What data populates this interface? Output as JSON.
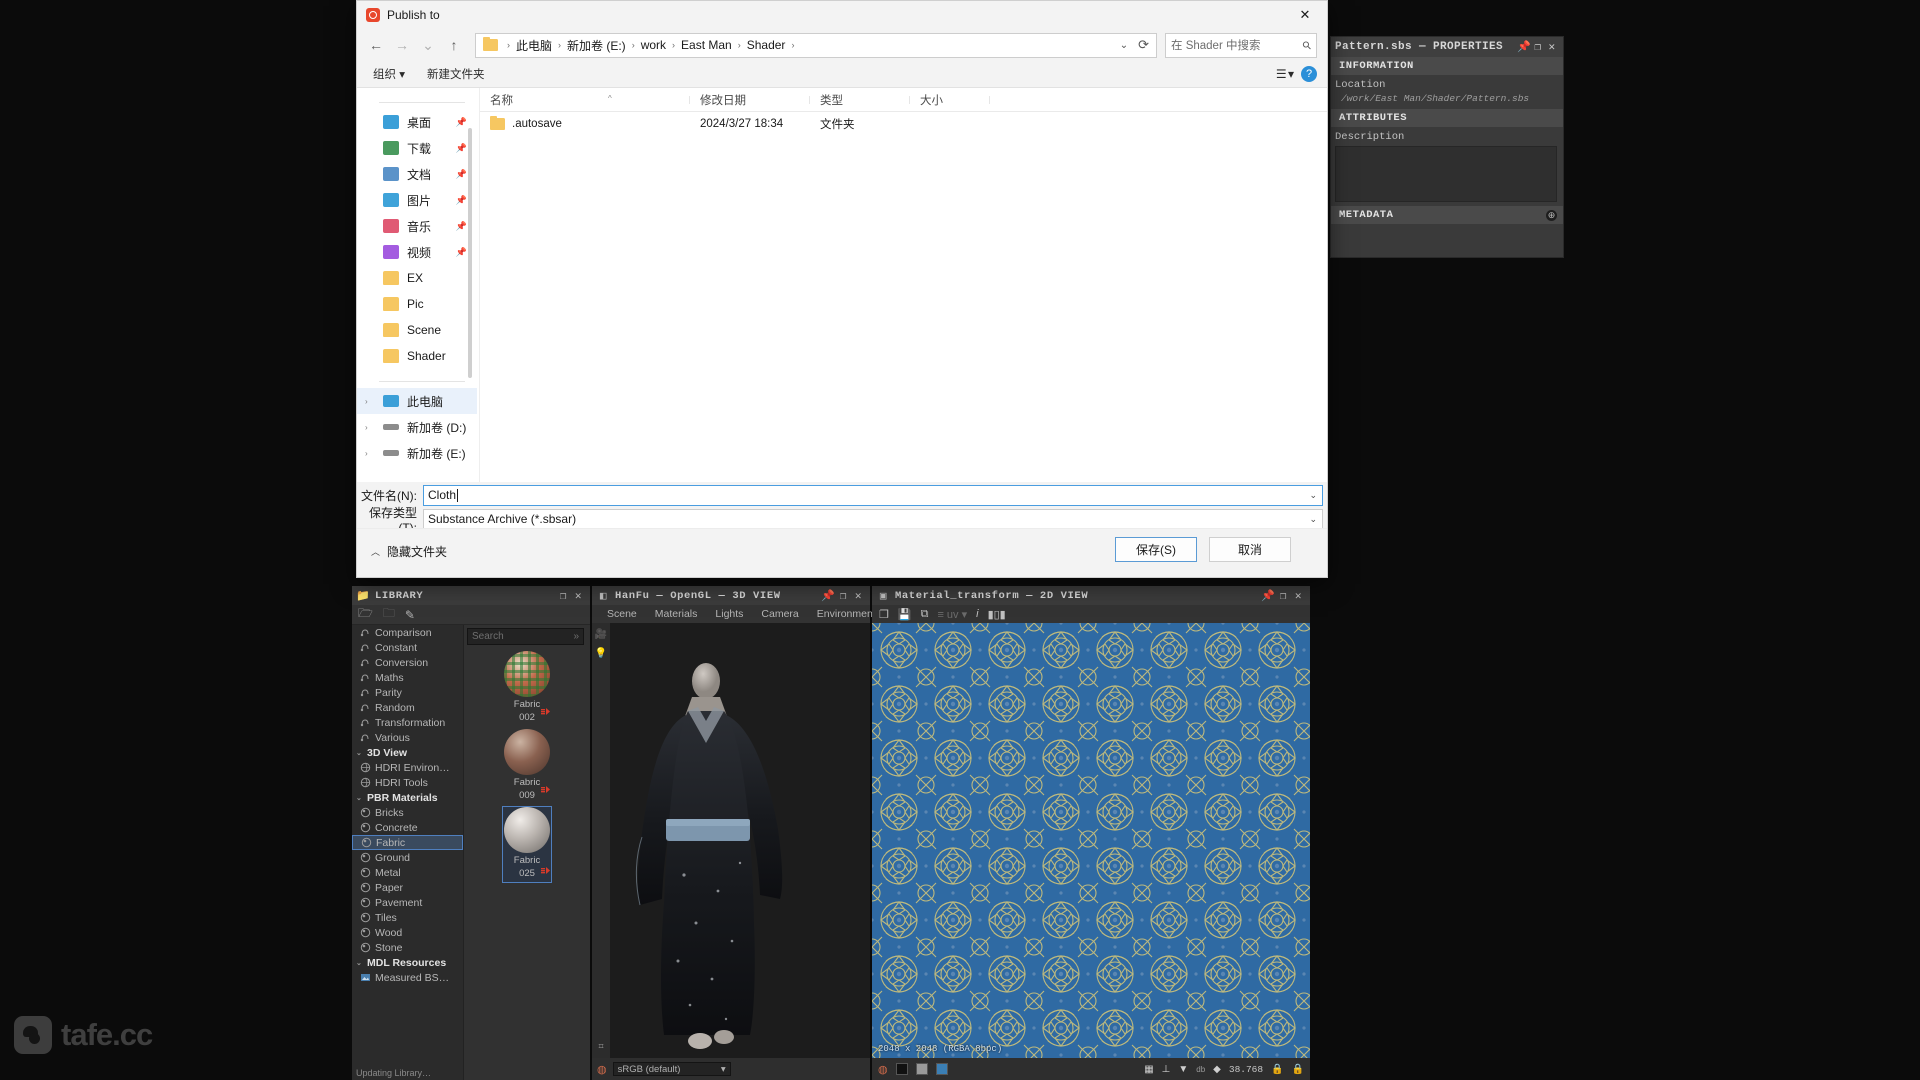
{
  "dialog": {
    "title": "Publish to",
    "close_label": "✕",
    "nav": {
      "back": "←",
      "forward": "→",
      "recent": "⌄",
      "up": "↑"
    },
    "breadcrumb": {
      "segments": [
        "此电脑",
        "新加卷 (E:)",
        "work",
        "East Man",
        "Shader"
      ],
      "separator": "›",
      "dropdown": "⌄",
      "refresh": "⟳"
    },
    "search": {
      "placeholder": "在 Shader 中搜索",
      "icon": "search-icon"
    },
    "commands": {
      "organize": "组织 ▾",
      "new_folder": "新建文件夹",
      "view_button": "☰ ▾",
      "help_button": "?"
    },
    "nav_pane": {
      "quick_access": [
        {
          "label": "桌面",
          "icon": "desktop-icon",
          "pinned": true
        },
        {
          "label": "下载",
          "icon": "downloads-icon",
          "pinned": true
        },
        {
          "label": "文档",
          "icon": "documents-icon",
          "pinned": true
        },
        {
          "label": "图片",
          "icon": "pictures-icon",
          "pinned": true
        },
        {
          "label": "音乐",
          "icon": "music-icon",
          "pinned": true
        },
        {
          "label": "视频",
          "icon": "videos-icon",
          "pinned": true
        },
        {
          "label": "EX",
          "icon": "folder-icon",
          "pinned": false
        },
        {
          "label": "Pic",
          "icon": "folder-icon",
          "pinned": false
        },
        {
          "label": "Scene",
          "icon": "folder-icon",
          "pinned": false
        },
        {
          "label": "Shader",
          "icon": "folder-icon",
          "pinned": false
        }
      ],
      "tree": [
        {
          "label": "此电脑",
          "icon": "computer-icon",
          "expander": "›",
          "selected": true
        },
        {
          "label": "新加卷 (D:)",
          "icon": "drive-icon",
          "expander": "›",
          "selected": false
        },
        {
          "label": "新加卷 (E:)",
          "icon": "drive-icon",
          "expander": "›",
          "selected": false
        }
      ]
    },
    "columns": {
      "name": "名称",
      "date": "修改日期",
      "type": "类型",
      "size": "大小",
      "sort_marker": "^"
    },
    "files": [
      {
        "name": ".autosave",
        "date": "2024/3/27 18:34",
        "type": "文件夹",
        "size": ""
      }
    ],
    "form": {
      "filename_label": "文件名(N):",
      "filename_value": "Cloth",
      "savetype_label": "保存类型(T):",
      "savetype_value": "Substance Archive (*.sbsar)",
      "dropdown_caret": "⌄"
    },
    "footer": {
      "hide_folders": "隐藏文件夹",
      "hide_folders_chevron": "︿",
      "save": "保存(S)",
      "cancel": "取消"
    }
  },
  "properties_panel": {
    "title": "Pattern.sbs — PROPERTIES",
    "pin_icon": "📌",
    "maximize_icon": "❐",
    "close_icon": "✕",
    "sections": {
      "information": "INFORMATION",
      "attributes": "ATTRIBUTES",
      "metadata": "METADATA"
    },
    "location_label": "Location",
    "location_value": "/work/East Man/Shader/Pattern.sbs",
    "description_label": "Description",
    "description_value": "",
    "metadata_add": "⊕"
  },
  "library_panel": {
    "title": "LIBRARY",
    "folder_icon": "📁",
    "maximize_icon": "❐",
    "close_icon": "✕",
    "tools": [
      "new-library-icon",
      "import-icon",
      "edit-pencil-icon"
    ],
    "search_placeholder": "Search",
    "search_expand": "»",
    "tree": [
      {
        "label": "Comparison",
        "type": "function",
        "indent": 1
      },
      {
        "label": "Constant",
        "type": "function",
        "indent": 1
      },
      {
        "label": "Conversion",
        "type": "function",
        "indent": 1
      },
      {
        "label": "Maths",
        "type": "function",
        "indent": 1
      },
      {
        "label": "Parity",
        "type": "function",
        "indent": 1
      },
      {
        "label": "Random",
        "type": "function",
        "indent": 1
      },
      {
        "label": "Transformation",
        "type": "function",
        "indent": 1
      },
      {
        "label": "Various",
        "type": "function",
        "indent": 1
      },
      {
        "label": "3D View",
        "type": "group",
        "indent": 0,
        "chevron": "⌄"
      },
      {
        "label": "HDRI Environ…",
        "type": "globe",
        "indent": 1
      },
      {
        "label": "HDRI Tools",
        "type": "globe",
        "indent": 1
      },
      {
        "label": "PBR Materials",
        "type": "group",
        "indent": 0,
        "chevron": "⌄"
      },
      {
        "label": "Bricks",
        "type": "sphere",
        "indent": 1
      },
      {
        "label": "Concrete",
        "type": "sphere",
        "indent": 1
      },
      {
        "label": "Fabric",
        "type": "sphere",
        "indent": 1,
        "selected": true
      },
      {
        "label": "Ground",
        "type": "sphere",
        "indent": 1
      },
      {
        "label": "Metal",
        "type": "sphere",
        "indent": 1
      },
      {
        "label": "Paper",
        "type": "sphere",
        "indent": 1
      },
      {
        "label": "Pavement",
        "type": "sphere",
        "indent": 1
      },
      {
        "label": "Tiles",
        "type": "sphere",
        "indent": 1
      },
      {
        "label": "Wood",
        "type": "sphere",
        "indent": 1
      },
      {
        "label": "Stone",
        "type": "sphere",
        "indent": 1
      },
      {
        "label": "MDL Resources",
        "type": "group",
        "indent": 0,
        "chevron": "⌄"
      },
      {
        "label": "Measured BS…",
        "type": "image",
        "indent": 1
      }
    ],
    "status": "Updating Library…",
    "items": [
      {
        "name_line1": "Fabric",
        "name_line2": "002",
        "selected": false,
        "color": "#b8704a"
      },
      {
        "name_line1": "Fabric",
        "name_line2": "009",
        "selected": false,
        "color": "#8a6150"
      },
      {
        "name_line1": "Fabric",
        "name_line2": "025",
        "selected": true,
        "color": "#b9b3ae"
      }
    ]
  },
  "view3d_panel": {
    "title": "HanFu — OpenGL — 3D VIEW",
    "cube_icon": "◧",
    "pin_icon": "📌",
    "maximize_icon": "❐",
    "close_icon": "✕",
    "tabs": [
      "Scene",
      "Materials",
      "Lights",
      "Camera",
      "Environment"
    ],
    "side_tools": [
      "camera-icon",
      "light-icon"
    ],
    "bottom": {
      "shader_icon": "material-icon",
      "colorspace": "sRGB (default)",
      "caret": "▾"
    }
  },
  "view2d_panel": {
    "title": "Material_transform — 2D VIEW",
    "checker_icon": "▣",
    "pin_icon": "📌",
    "maximize_icon": "❐",
    "close_icon": "✕",
    "tools": [
      "duplicate-icon",
      "save-icon",
      "copy-icon",
      "uv-icon",
      "info-icon",
      "histogram-icon"
    ],
    "status": "2048 x 2048 (RGBA 8bpc)",
    "bottom": {
      "material_icon": "material-icon",
      "swatches": [
        "#111111",
        "#9a9a9a",
        "#3b7fb5"
      ],
      "grid_icon": "grid-icon",
      "tone_icon": "tone-icon",
      "filter_icon": "filter-icon",
      "alpha_icon": "alpha-icon",
      "zoom_value": "38.768",
      "lock_icon": "lock-icon",
      "lock_icon_2": "lock-icon"
    }
  },
  "watermark": {
    "text": "tafe.cc",
    "icon": "tafe-logo-icon"
  },
  "colors": {
    "accent_blue": "#4f7fbf",
    "dialog_bg": "#f3f3f3",
    "panel_bg": "#2e2e2e",
    "pattern_blue": "#2f6aa3",
    "pattern_gold": "#c9c07a"
  }
}
